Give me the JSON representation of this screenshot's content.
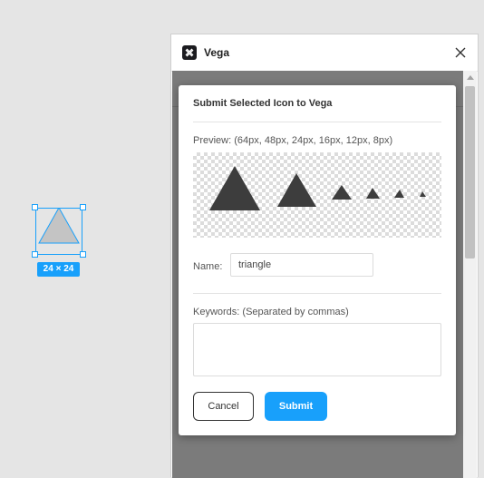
{
  "canvas": {
    "size_badge": "24 × 24",
    "selected_shape": "triangle"
  },
  "window": {
    "title": "Vega",
    "logo_icon": "vega-logo-icon",
    "close_icon": "close-icon"
  },
  "modal": {
    "title": "Submit Selected Icon to Vega",
    "preview_label": "Preview: (64px, 48px, 24px, 16px, 12px, 8px)",
    "name_label": "Name:",
    "name_value": "triangle",
    "keywords_label": "Keywords: (Separated by commas)",
    "keywords_value": "",
    "cancel_label": "Cancel",
    "submit_label": "Submit"
  },
  "colors": {
    "accent": "#18a0fb",
    "icon_fill": "#3d3d3d",
    "canvas_shape_fill": "#c4c4c4"
  }
}
